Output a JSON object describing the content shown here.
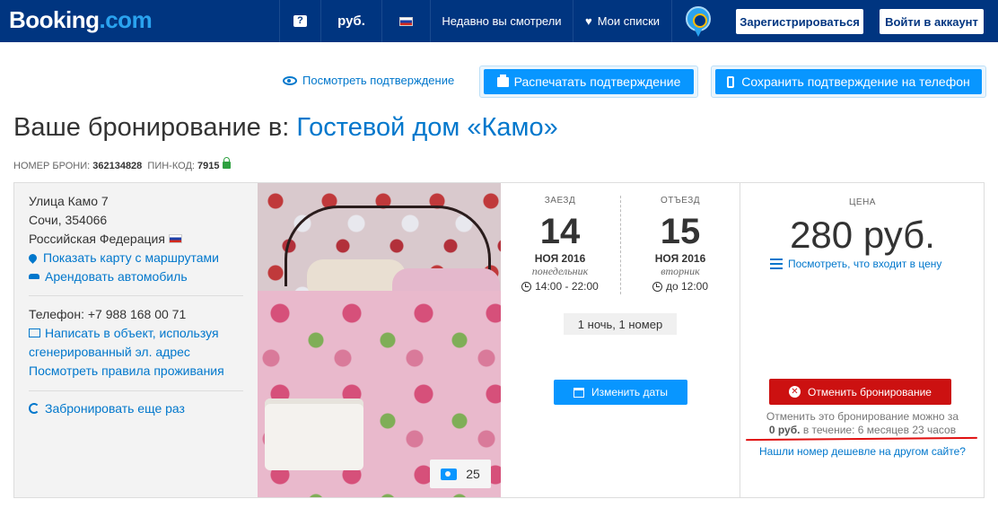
{
  "header": {
    "logo_main": "Booking",
    "logo_suffix": ".com",
    "help_icon": "?",
    "currency": "руб.",
    "language_flag": "flag-ru-icon",
    "recently_viewed": "Недавно вы смотрели",
    "my_lists": "Мои списки",
    "register": "Зарегистрироваться",
    "login": "Войти в аккаунт"
  },
  "actions": {
    "view_confirmation": "Посмотреть подтверждение",
    "print_confirmation": "Распечатать подтверждение",
    "save_to_phone": "Сохранить подтверждение на телефон"
  },
  "booking": {
    "title_prefix": "Ваше бронирование в: ",
    "hotel_name": "Гостевой дом «Камо»",
    "number_label": "НОМЕР БРОНИ: ",
    "number": "362134828",
    "pin_label": "ПИН-КОД: ",
    "pin": "7915"
  },
  "address": {
    "street": "Улица Камо 7",
    "city": "Сочи, 354066",
    "country": "Российская Федерация",
    "map_link": "Показать карту с маршрутами",
    "car_link": "Арендовать автомобиль",
    "phone": "Телефон: +7 988 168 00 71",
    "email_link_line1": "Написать в объект, используя",
    "email_link_line2": "сгенерированный эл. адрес",
    "rules_link": "Посмотреть правила проживания",
    "book_again": "Забронировать еще раз"
  },
  "photo": {
    "count": "25"
  },
  "dates": {
    "checkin_label": "ЗАЕЗД",
    "checkin_day": "14",
    "checkin_month": "НОЯ 2016",
    "checkin_dow": "понедельник",
    "checkin_time": "14:00 - 22:00",
    "checkout_label": "ОТЪЕЗД",
    "checkout_day": "15",
    "checkout_month": "НОЯ 2016",
    "checkout_dow": "вторник",
    "checkout_time": "до 12:00",
    "nights": "1 ночь, 1 номер",
    "change_dates": "Изменить даты"
  },
  "price": {
    "label": "ЦЕНА",
    "value": "280 руб.",
    "details_link": "Посмотреть, что входит в цену",
    "cancel_button": "Отменить бронирование",
    "cancel_note_line1": "Отменить это бронирование можно за",
    "cancel_note_amount": "0 руб.",
    "cancel_note_rest": " в течение: 6 месяцев 23 часов",
    "cheaper_link": "Нашли номер дешевле на другом сайте?"
  },
  "colors": {
    "brand_blue": "#003580",
    "accent_blue": "#0896ff",
    "link_blue": "#0077cc",
    "cancel_red": "#cc1111"
  }
}
